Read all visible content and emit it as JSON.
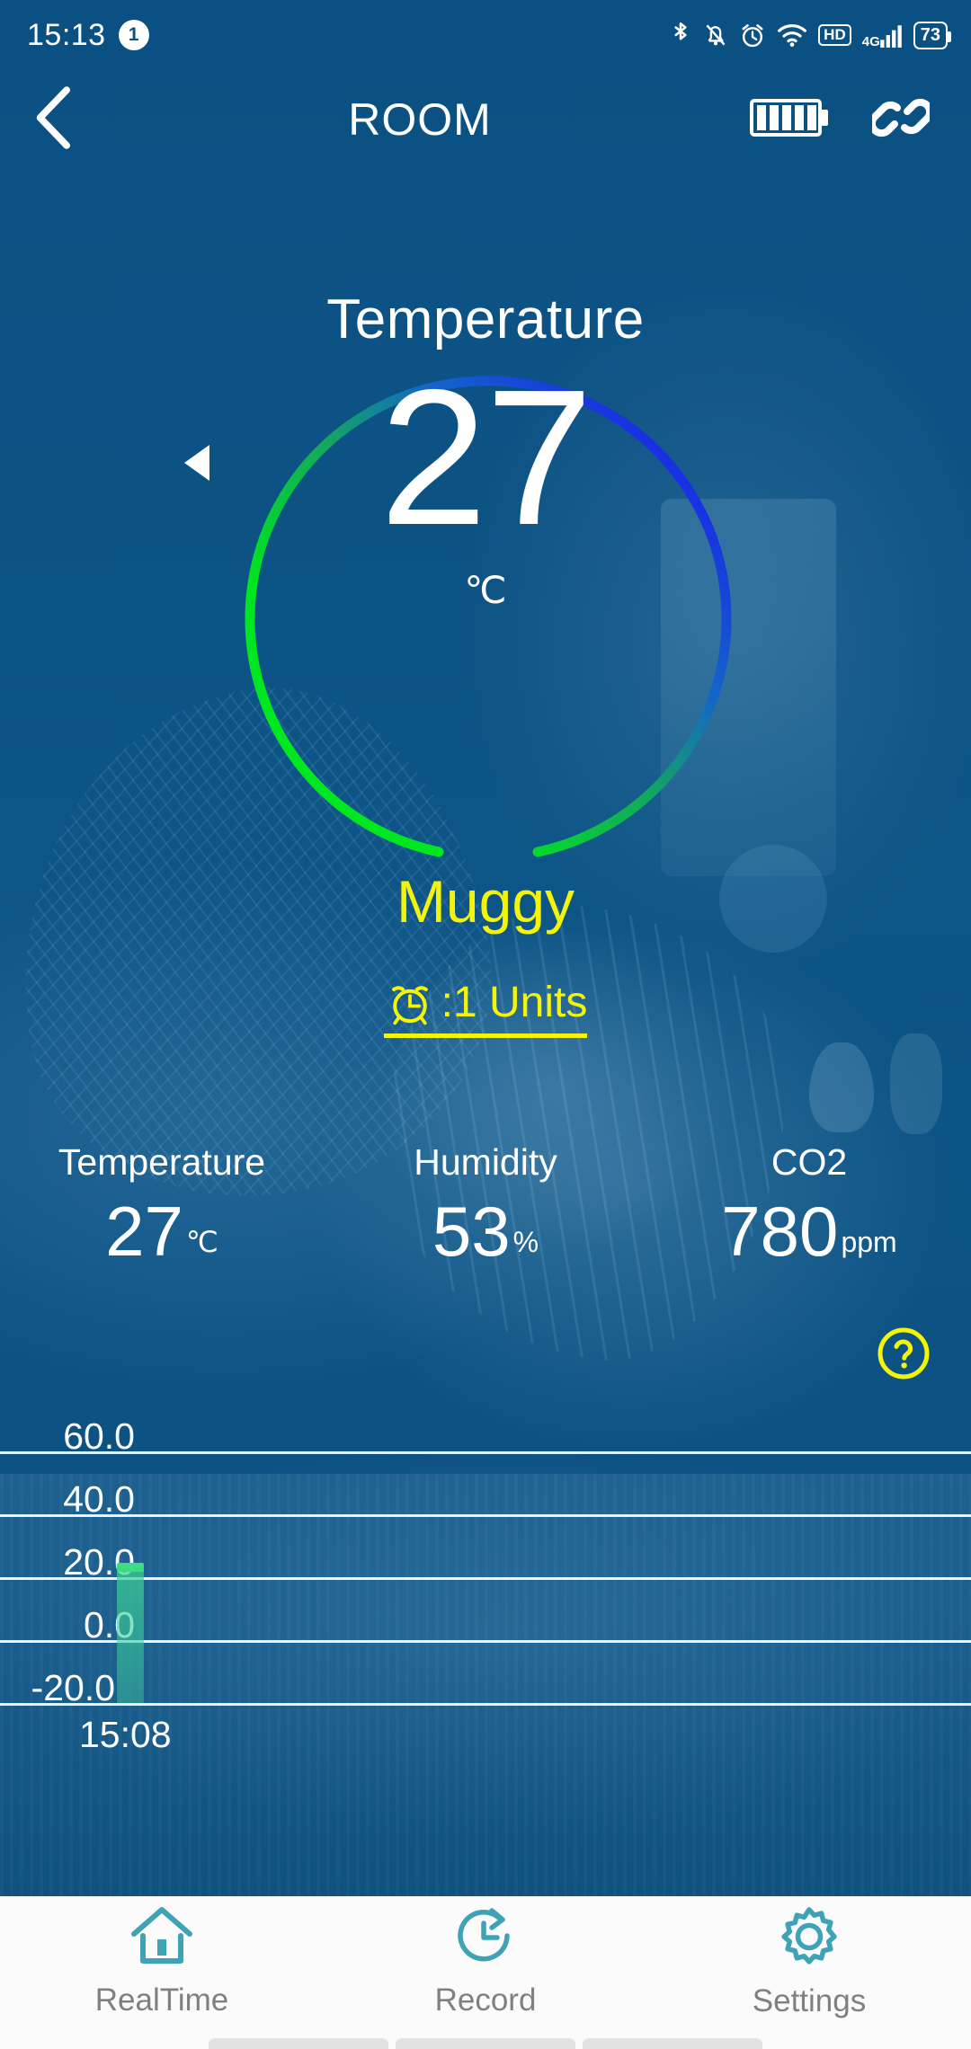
{
  "statusbar": {
    "time": "15:13",
    "notification_count": "1",
    "icons": [
      "bluetooth-icon",
      "bell-muted-icon",
      "alarm-icon",
      "wifi-icon",
      "hd-icon",
      "4g-signal-icon",
      "battery-icon"
    ],
    "hd_label": "HD",
    "network_label": "4G",
    "battery_percent": "73"
  },
  "header": {
    "back_icon": "chevron-left-icon",
    "title": "ROOM",
    "device_battery_icon": "battery-full-icon",
    "link_icon": "chain-link-icon"
  },
  "gauge": {
    "label": "Temperature",
    "value": "27",
    "unit": "℃",
    "status_word": "Muggy",
    "alarm_icon": "alarm-clock-icon",
    "alarm_text": ":1 Units",
    "arc_start_color": "#00e529",
    "arc_mid_color": "#0aa36a",
    "arc_end_color": "#1a14f0",
    "marker_icon": "triangle-left-marker",
    "status_color": "#f4f408"
  },
  "metrics": [
    {
      "label": "Temperature",
      "value": "27",
      "unit": "℃"
    },
    {
      "label": "Humidity",
      "value": "53",
      "unit": "%"
    },
    {
      "label": "CO2",
      "value": "780",
      "unit": "ppm"
    }
  ],
  "help": {
    "icon": "question-circle-icon",
    "color": "#f4f408"
  },
  "chart_data": {
    "type": "bar",
    "title": "",
    "xlabel": "",
    "ylabel": "",
    "categories": [
      "15:08"
    ],
    "values": [
      27
    ],
    "series": [
      {
        "name": "Temperature",
        "values": [
          27
        ]
      }
    ],
    "ytick_labels": [
      "60.0",
      "40.0",
      "20.0",
      "0.0",
      "-20.0"
    ],
    "ytick_values": [
      60,
      40,
      20,
      0,
      -20
    ],
    "ylim": [
      -30,
      70
    ],
    "xtick_labels": [
      "15:08"
    ],
    "grid": true,
    "legend": "none",
    "bar_color": "#3ddc84"
  },
  "bottomnav": [
    {
      "label": "RealTime",
      "icon": "home-icon",
      "active": true
    },
    {
      "label": "Record",
      "icon": "clock-history-icon",
      "active": false
    },
    {
      "label": "Settings",
      "icon": "gear-icon",
      "active": false
    }
  ],
  "colors": {
    "background": "#0b5082",
    "accent_teal": "#3fa3b5",
    "yellow": "#f4f408"
  }
}
